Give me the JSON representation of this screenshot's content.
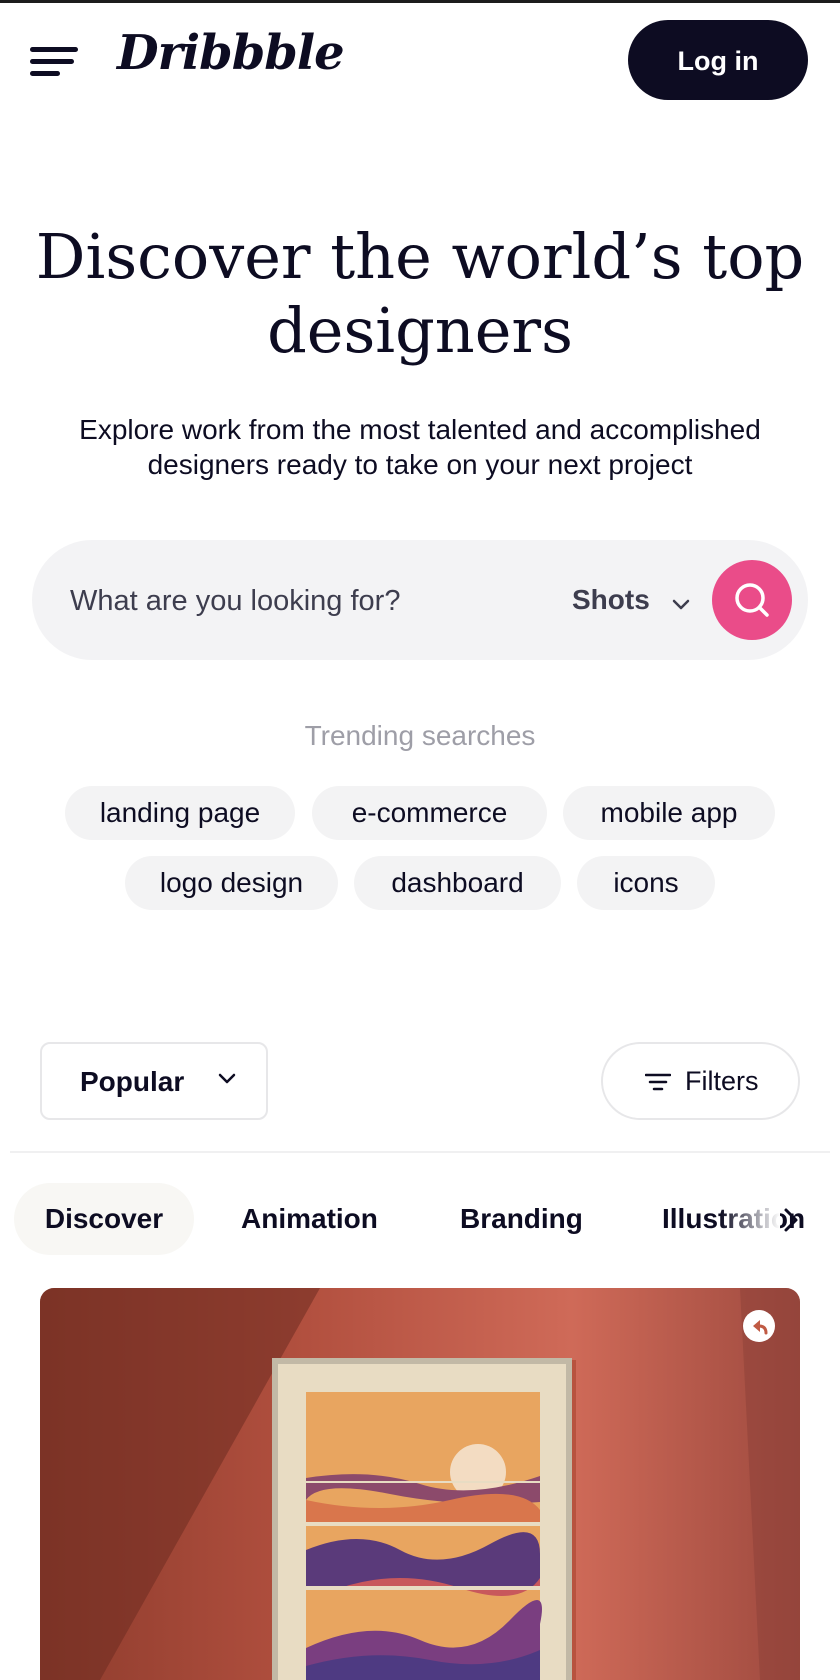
{
  "header": {
    "logo_text": "Dribbble",
    "login_label": "Log in"
  },
  "hero": {
    "title": "Discover the world’s top designers",
    "subtitle": "Explore work from the most talented and accomplished designers ready to take on your next project"
  },
  "search": {
    "placeholder": "What are you looking for?",
    "type_label": "Shots",
    "accent_color": "#ea4c89"
  },
  "trending": {
    "label": "Trending searches",
    "tags": [
      "landing page",
      "e-commerce",
      "mobile app",
      "logo design",
      "dashboard",
      "icons"
    ]
  },
  "controls": {
    "sort_label": "Popular",
    "filters_label": "Filters"
  },
  "categories": {
    "items": [
      "Discover",
      "Animation",
      "Branding",
      "Illustration"
    ],
    "active": "Discover"
  },
  "icons": {
    "menu": "hamburger-icon",
    "search": "search-icon",
    "dropdown": "chevron-down-icon",
    "filters": "filter-icon",
    "next": "chevron-right-icon",
    "shot_action": "share-icon"
  }
}
